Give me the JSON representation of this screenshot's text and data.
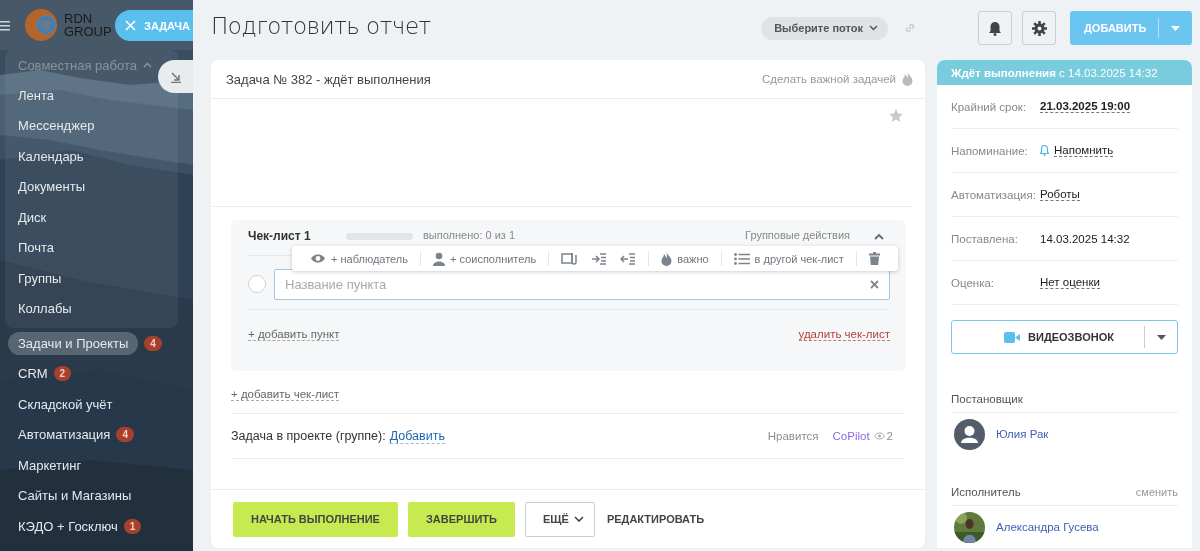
{
  "sidebar": {
    "logo": {
      "line_1": "RDN",
      "line_2": "GROUP"
    },
    "task_button": "ЗАДАЧА",
    "group": {
      "label": "Совместная работа",
      "expanded": true,
      "items": [
        {
          "label": "Лента",
          "selected": false
        },
        {
          "label": "Мессенджер",
          "selected": false
        },
        {
          "label": "Календарь",
          "selected": false
        },
        {
          "label": "Документы",
          "selected": false
        },
        {
          "label": "Диск",
          "selected": false
        },
        {
          "label": "Почта",
          "selected": false
        },
        {
          "label": "Группы",
          "selected": false
        },
        {
          "label": "Коллабы",
          "selected": false
        }
      ]
    },
    "items": [
      {
        "label": "Задачи и Проекты",
        "selected": true,
        "counter": "4"
      },
      {
        "label": "CRM",
        "selected": false,
        "counter": "2"
      },
      {
        "label": "Складской учёт",
        "selected": false
      },
      {
        "label": "Автоматизация",
        "selected": false,
        "counter": "4"
      },
      {
        "label": "Маркетинг",
        "selected": false
      },
      {
        "label": "Сайты и Магазины",
        "selected": false
      },
      {
        "label": "КЭДО + Госключ",
        "selected": false,
        "counter": "1"
      }
    ]
  },
  "header": {
    "title": "Подготовить отчет",
    "flow_select": "Выберите поток",
    "add_button": "ДОБАВИТЬ"
  },
  "task": {
    "heading": "Задача № 382 - ждёт выполнения",
    "important_link": "Сделать важной задачей",
    "checklist": {
      "title": "Чек-лист 1",
      "level": 0,
      "progress": "выполнено: 0 из 1",
      "group_actions": "Групповые действия",
      "expanded": true,
      "toolbar": [
        {
          "kind": "observer",
          "label": "+ наблюдатель"
        },
        {
          "kind": "coexecutor",
          "label": "+ соисполнитель"
        },
        {
          "kind": "attach"
        },
        {
          "kind": "indent"
        },
        {
          "kind": "outdent"
        },
        {
          "kind": "important",
          "label": "важно"
        },
        {
          "kind": "move",
          "label": "в другой чек-лист"
        },
        {
          "kind": "delete"
        }
      ],
      "item_field": {
        "checked": false,
        "placeholder": "Название пункта"
      },
      "add_item": "+ добавить пункт",
      "delete": "удалить чек-лист"
    },
    "add_checklist": "+ добавить чек-лист",
    "project": {
      "label": "Задача в проекте (группе):",
      "link": "Добавить"
    },
    "likes": "Нравится",
    "copilot": "CoPilot",
    "views": "2",
    "actions": [
      {
        "kind": "primary",
        "label": "НАЧАТЬ ВЫПОЛНЕНИЕ"
      },
      {
        "kind": "primary",
        "label": "ЗАВЕРШИТЬ"
      },
      {
        "kind": "menu",
        "label": "ЕЩЁ"
      },
      {
        "kind": "link",
        "label": "РЕДАКТИРОВАТЬ"
      }
    ]
  },
  "panel": {
    "status": "**Ждёт выполнения** с 14.03.2025 14:32",
    "fields": [
      {
        "label": "Крайний срок:",
        "value": "21.03.2025 19:00",
        "kind": "strong-link"
      },
      {
        "label": "Напоминание:",
        "value": "Напомнить",
        "kind": "reminder"
      },
      {
        "label": "Автоматизация:",
        "value": "Роботы",
        "kind": "link"
      },
      {
        "label": "Поставлена:",
        "value": "14.03.2025 14:32",
        "kind": "plain"
      },
      {
        "label": "Оценка:",
        "value": "Нет оценки",
        "kind": "link"
      }
    ],
    "video_button": "ВИДЕОЗВОНОК",
    "people": [
      {
        "role": "Постановщик",
        "name": "Юлия Рак",
        "kind": "silhouette"
      },
      {
        "role": "Исполнитель",
        "action": "сменить",
        "name": "Александра Гусева",
        "kind": "picture"
      }
    ]
  }
}
